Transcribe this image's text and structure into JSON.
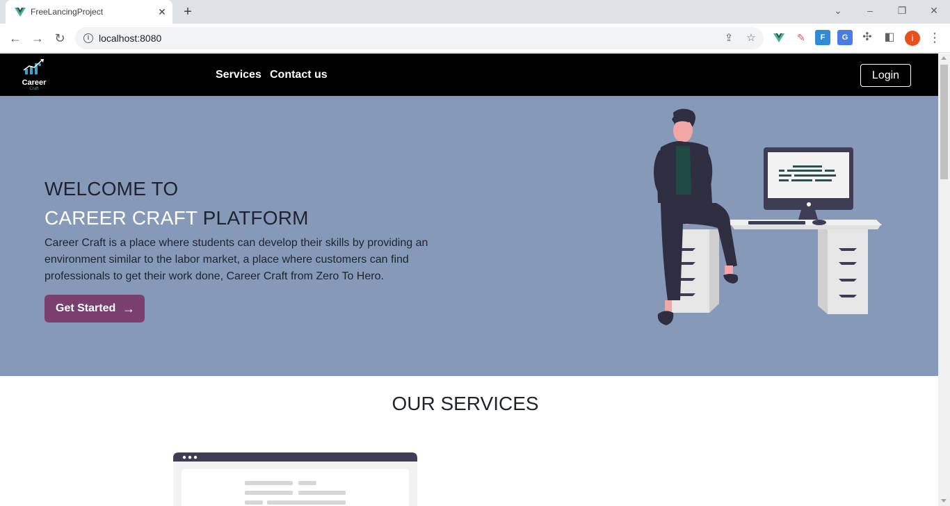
{
  "browser": {
    "tab_title": "FreeLancingProject",
    "url": "localhost:8080",
    "profile_initial": "i"
  },
  "navbar": {
    "logo_text": "Career",
    "logo_sub": "Craft",
    "links": [
      "Services",
      "Contact us"
    ],
    "login_label": "Login"
  },
  "hero": {
    "title_line1": "WELCOME TO",
    "title_accent": "CAREER CRAFT",
    "title_rest": " PLATFORM",
    "description": "Career Craft is a place where students can develop their skills by providing an environment similar to the labor market, a place where customers can find professionals to get their work done, Career Craft from Zero To Hero.",
    "cta_label": "Get Started"
  },
  "services": {
    "title": "OUR SERVICES"
  },
  "colors": {
    "navbar": "#000000",
    "hero_bg": "#8699b8",
    "cta": "#7a3f6e"
  }
}
